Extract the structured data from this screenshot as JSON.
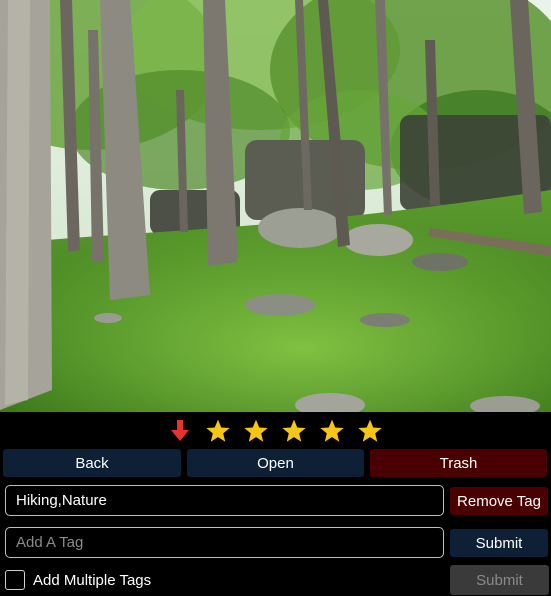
{
  "photo": {
    "subject": "forest-trail-image"
  },
  "rating": {
    "arrow_icon": "arrow-down-icon",
    "arrow_color": "#e8332b",
    "star_icon": "star-icon",
    "star_color": "#f5c518",
    "stars": 5
  },
  "nav": {
    "back_label": "Back",
    "open_label": "Open",
    "trash_label": "Trash"
  },
  "tags": {
    "current_value": "Hiking,Nature",
    "remove_label": "Remove Tag",
    "add_placeholder": "Add A Tag",
    "submit_label": "Submit",
    "multi_label": "Add Multiple Tags",
    "multi_checked": false,
    "multi_submit_label": "Submit"
  },
  "colors": {
    "background": "#000000",
    "nav_button": "#0e2036",
    "trash_button": "#4a0000",
    "remove_tag_button": "#4a0000",
    "submit_button": "#0e2036",
    "disabled_button": "#3a3a3a",
    "disabled_text": "#8a8a8a"
  }
}
